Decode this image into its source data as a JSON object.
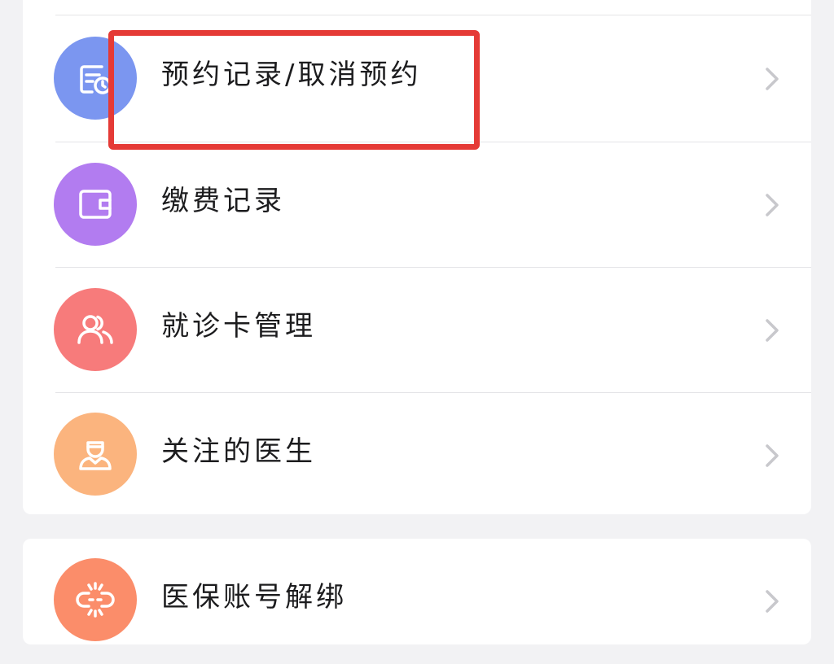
{
  "menu_group_1": {
    "items": [
      {
        "label": "预约记录/取消预约",
        "icon": "appointment-record-icon",
        "color": "#7b96f0"
      },
      {
        "label": "缴费记录",
        "icon": "wallet-icon",
        "color": "#b27cf0"
      },
      {
        "label": "就诊卡管理",
        "icon": "users-icon",
        "color": "#f77b7b"
      },
      {
        "label": "关注的医生",
        "icon": "doctor-icon",
        "color": "#fbb47e"
      }
    ]
  },
  "menu_group_2": {
    "items": [
      {
        "label": "医保账号解绑",
        "icon": "unlink-icon",
        "color": "#fb8d6a"
      }
    ]
  },
  "colors": {
    "highlight": "#e53a36",
    "chevron": "#c8c8cc",
    "background": "#f2f2f4"
  }
}
